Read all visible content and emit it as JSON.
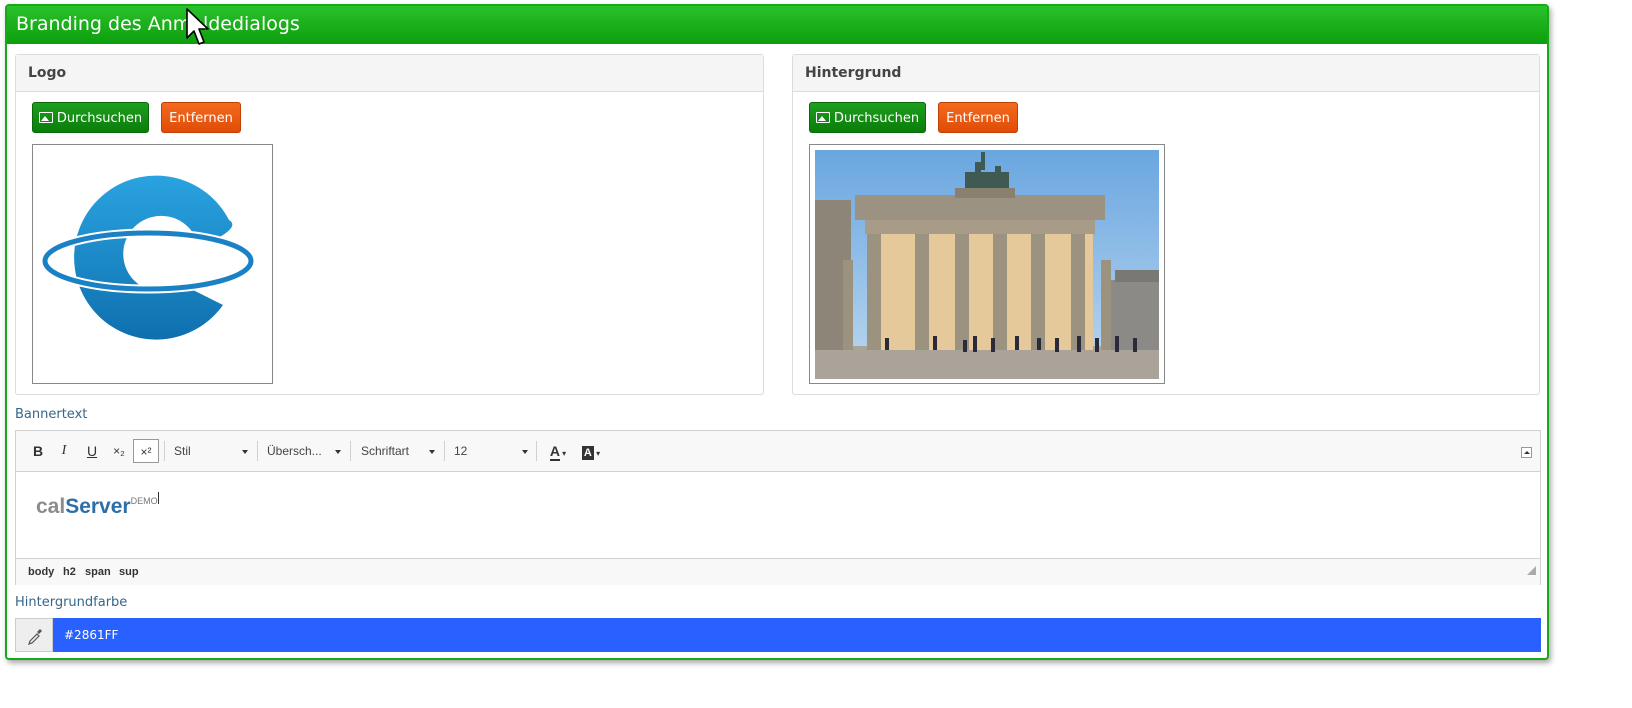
{
  "window": {
    "title": "Branding des Anmeldedialogs"
  },
  "logo_panel": {
    "heading": "Logo",
    "browse_label": "Durchsuchen",
    "remove_label": "Entfernen"
  },
  "background_panel": {
    "heading": "Hintergrund",
    "browse_label": "Durchsuchen",
    "remove_label": "Entfernen"
  },
  "banner_text": {
    "label": "Bannertext",
    "toolbar": {
      "bold": "B",
      "italic": "I",
      "underline": "U",
      "subscript": "×₂",
      "superscript": "×²",
      "style_combo": "Stil",
      "heading_combo": "Übersch...",
      "font_combo": "Schriftart",
      "size_combo": "12",
      "text_color": "A",
      "bg_color": "A"
    },
    "content": {
      "part1": "cal",
      "part2": "Server",
      "sup": "DEMO"
    },
    "path": [
      "body",
      "h2",
      "span",
      "sup"
    ]
  },
  "background_color": {
    "label": "Hintergrundfarbe",
    "value": "#2861FF"
  },
  "colors": {
    "title_green": "#17a917",
    "button_green": "#0a7d0a",
    "button_orange": "#e04c07",
    "label_blue": "#35668a",
    "swatch": "#2861FF"
  }
}
